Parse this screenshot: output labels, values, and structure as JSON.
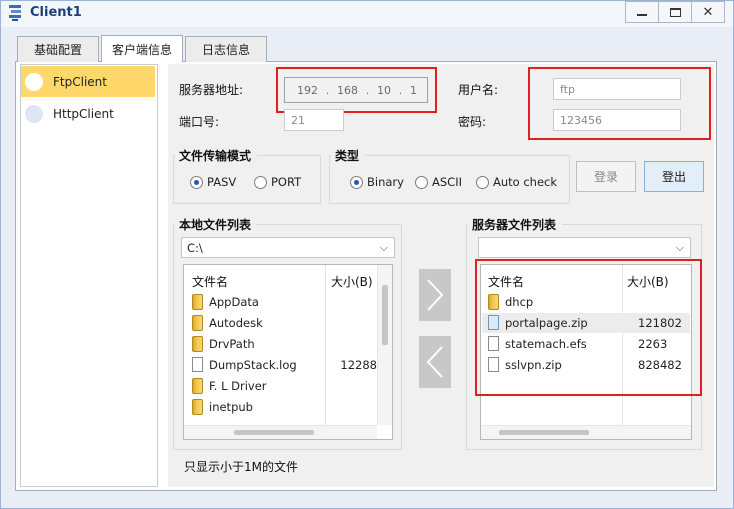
{
  "window": {
    "title": "Client1"
  },
  "tabs": [
    {
      "label": "基础配置",
      "active": false
    },
    {
      "label": "客户端信息",
      "active": true
    },
    {
      "label": "日志信息",
      "active": false
    }
  ],
  "sidebar": {
    "items": [
      {
        "label": "FtpClient",
        "active": true
      },
      {
        "label": "HttpClient",
        "active": false
      }
    ]
  },
  "server": {
    "address_label": "服务器地址:",
    "ip": [
      "192",
      "168",
      "10",
      "1"
    ],
    "port_label": "端口号:",
    "port": "21",
    "username_label": "用户名:",
    "username": "ftp",
    "password_label": "密码:",
    "password": "123456"
  },
  "transfer_mode": {
    "title": "文件传输模式",
    "options": [
      {
        "label": "PASV",
        "selected": true
      },
      {
        "label": "PORT",
        "selected": false
      }
    ]
  },
  "type": {
    "title": "类型",
    "options": [
      {
        "label": "Binary",
        "selected": true
      },
      {
        "label": "ASCII",
        "selected": false
      },
      {
        "label": "Auto check",
        "selected": false
      }
    ]
  },
  "buttons": {
    "login": "登录",
    "logout": "登出"
  },
  "local": {
    "title": "本地文件列表",
    "path": "C:\\",
    "col_name": "文件名",
    "col_size": "大小(B)",
    "files": [
      {
        "name": "AppData",
        "size": "",
        "kind": "folder"
      },
      {
        "name": "Autodesk",
        "size": "",
        "kind": "folder"
      },
      {
        "name": "DrvPath",
        "size": "",
        "kind": "folder"
      },
      {
        "name": "DumpStack.log",
        "size": "12288",
        "kind": "file"
      },
      {
        "name": "F. L Driver",
        "size": "",
        "kind": "folder"
      },
      {
        "name": "inetpub",
        "size": "",
        "kind": "folder"
      }
    ]
  },
  "remote": {
    "title": "服务器文件列表",
    "path": "",
    "col_name": "文件名",
    "col_size": "大小(B)",
    "files": [
      {
        "name": "dhcp",
        "size": "",
        "kind": "folder"
      },
      {
        "name": "portalpage.zip",
        "size": "121802",
        "kind": "zip"
      },
      {
        "name": "statemach.efs",
        "size": "2263",
        "kind": "file"
      },
      {
        "name": "sslvpn.zip",
        "size": "828482",
        "kind": "file"
      }
    ]
  },
  "footer_note": "只显示小于1M的文件",
  "colors": {
    "highlight": "#e02020",
    "active_item": "#ffd76b",
    "accent": "#1a56c4"
  }
}
